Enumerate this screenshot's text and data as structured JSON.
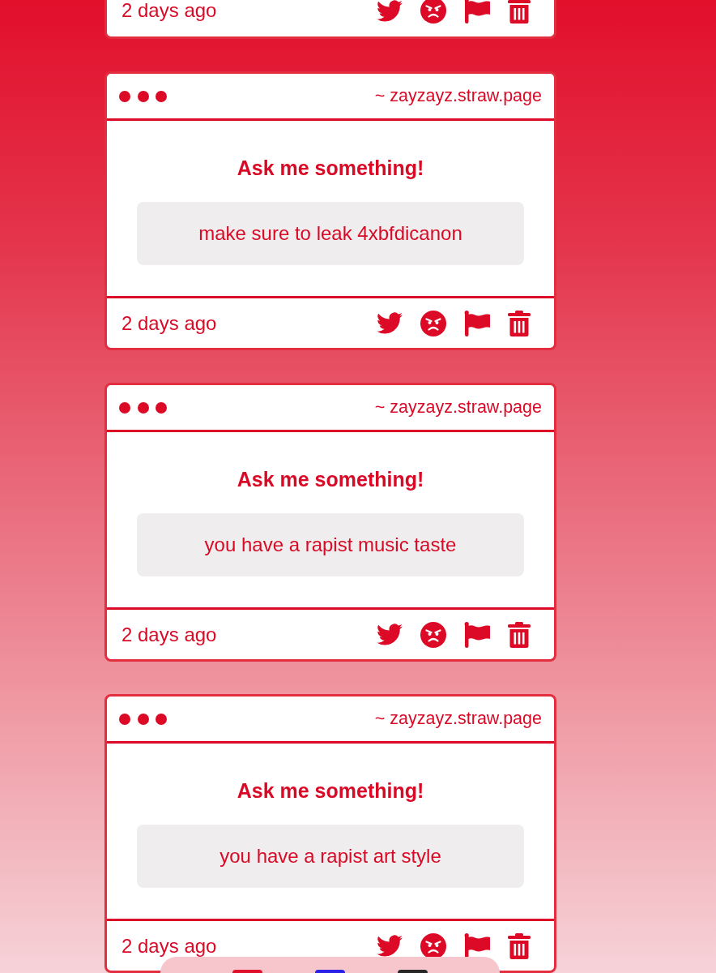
{
  "cards": [
    {
      "kind": "footer",
      "time": "2 days ago"
    },
    {
      "kind": "full",
      "url": "~ zayzayz.straw.page",
      "title": "Ask me something!",
      "message": "make sure to leak 4xbfdicanon",
      "time": "2 days ago"
    },
    {
      "kind": "full",
      "url": "~ zayzayz.straw.page",
      "title": "Ask me something!",
      "message": "you have a rapist music taste",
      "time": "2 days ago"
    },
    {
      "kind": "full",
      "url": "~ zayzayz.straw.page",
      "title": "Ask me something!",
      "message": "you have a rapist art style",
      "time": "2 days ago"
    }
  ]
}
